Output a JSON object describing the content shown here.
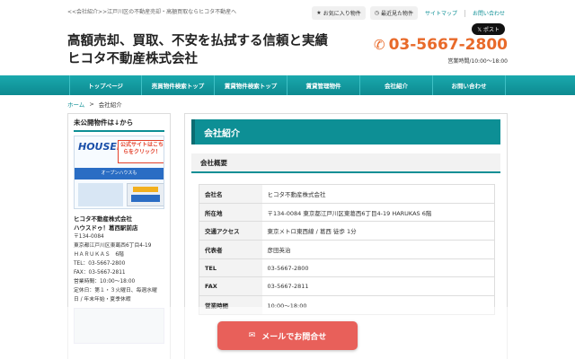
{
  "topbar": {
    "tagline": "<<会社紹介>>江戸川区の不動産売却・高額買取ならヒコタ不動産へ",
    "favorites": "お気に入り物件",
    "recent": "最近見た物件",
    "sitemap": "サイトマップ",
    "contact": "お問い合わせ"
  },
  "header": {
    "title_line1": "高額売却、買取、不安を払拭する信頼と実績",
    "title_line2": "ヒコタ不動産株式会社",
    "xpost": "ポスト",
    "phone": "03-5667-2800",
    "hours": "営業時間/10:00〜18:00"
  },
  "nav": [
    "トップページ",
    "売買物件検索トップ",
    "賃貸物件検索トップ",
    "賃貸管理物件",
    "会社紹介",
    "お問い合わせ"
  ],
  "breadcrumb": {
    "home": "ホーム",
    "sep": ">",
    "current": "会社紹介"
  },
  "sidebar": {
    "title": "未公開物件は↓から",
    "banner": {
      "logo_a": "HOUSE",
      "logo_b": "DO",
      "click_text": "公式サイトはこちらをクリック！",
      "strip": "オープンハウスも"
    },
    "company_name": "ヒコタ不動産株式会社",
    "shop_name": "ハウスドゥ！葛西駅前店",
    "postal": "〒134-0084",
    "address1": "東京都江戸川区東葛西6丁目4-19",
    "address2": "ＨＡＲＵＫＡＳ　6階",
    "tel": "TEL：03-5667-2800",
    "fax": "FAX：03-5667-2811",
    "hours": "営業時間：10:00〜18:00",
    "closed1": "定休日：第１・３火曜日、毎週水曜",
    "closed2": "日 / 年末年始・夏季休暇"
  },
  "content": {
    "heading": "会社紹介",
    "section": "会社概要",
    "rows": [
      {
        "k": "会社名",
        "v": "ヒコタ不動産株式会社"
      },
      {
        "k": "所在地",
        "v": "〒134-0084 東京都江戸川区東葛西6丁目4-19 HARUKAS 6階"
      },
      {
        "k": "交通アクセス",
        "v": "東京メトロ東西線 / 葛西 徒歩 1分"
      },
      {
        "k": "代表者",
        "v": "彦田英治"
      },
      {
        "k": "TEL",
        "v": "03-5667-2800"
      },
      {
        "k": "FAX",
        "v": "03-5667-2811"
      },
      {
        "k": "営業時間",
        "v": "10:00〜18:00"
      }
    ]
  },
  "mail_button": "メールでお問合せ",
  "colors": {
    "accent": "#0d8f95",
    "phone": "#e86a2a",
    "mail": "#e8605a"
  }
}
